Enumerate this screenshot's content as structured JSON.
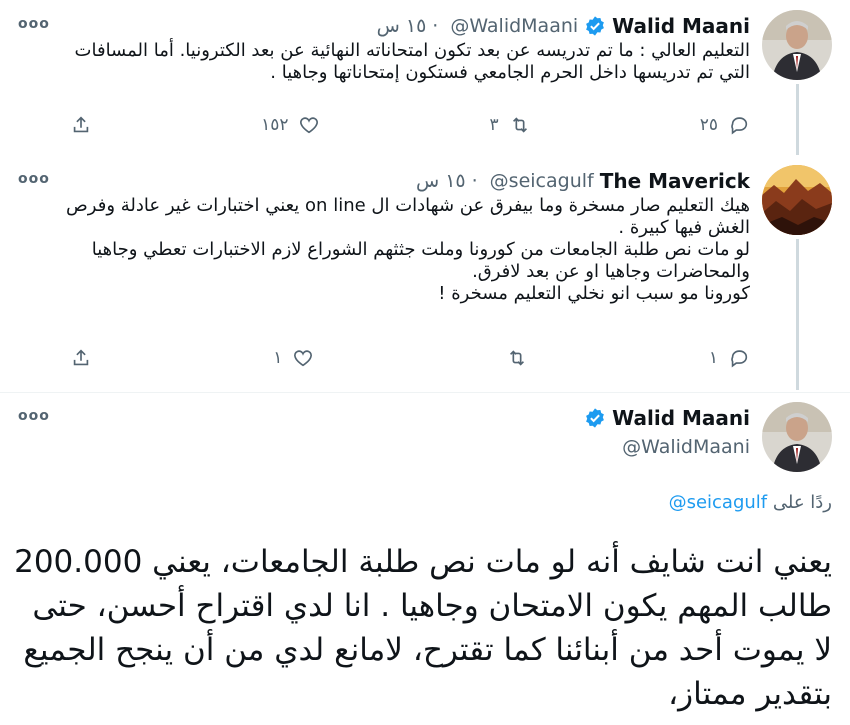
{
  "tweets": [
    {
      "name": "Walid Maani",
      "handle": "@WalidMaani",
      "time": "١٥ س",
      "text": "التعليم العالي : ما تم تدريسه عن بعد تكون امتحاناته النهائية عن بعد الكترونيا. أما المسافات التي تم تدريسها  داخل الحرم الجامعي فستكون إمتحاناتها وجاهيا .",
      "replies": "٢٥",
      "retweets": "٣",
      "likes": "١٥٢",
      "verified": true
    },
    {
      "name": "The Maverick",
      "handle": "@seicagulf",
      "time": "١٥ س",
      "text": "هيك التعليم صار مسخرة وما بيفرق عن شهادات ال on line يعني اختبارات غير عادلة وفرص الغش فيها كبيرة .\nلو مات نص طلبة الجامعات من كورونا وملت جثثهم الشوراع لازم الاختبارات تعطي وجاهيا والمحاضرات وجاهيا او عن بعد لافرق.\nكورونا مو سبب انو نخلي التعليم مسخرة !",
      "replies": "١",
      "retweets": "",
      "likes": "١",
      "verified": false
    }
  ],
  "main_tweet": {
    "name": "Walid Maani",
    "handle": "@WalidMaani",
    "reply_prefix": "ردًا على",
    "reply_handle": "@seicagulf",
    "text": "يعني انت شايف أنه لو مات نص طلبة الجامعات، يعني 200.000 طالب المهم يكون الامتحان وجاهيا . انا لدي اقتراح أحسن، حتى لا يموت أحد من أبنائنا كما تقترح، لامانع لدي من أن ينجح الجميع بتقدير ممتاز،"
  },
  "icons": {
    "more": "more-icon",
    "reply": "reply-icon",
    "retweet": "retweet-icon",
    "like": "like-icon",
    "share": "share-icon",
    "verified": "verified-badge-icon"
  },
  "more_label": "ooo",
  "colors": {
    "accent": "#1d9bf0",
    "muted": "#536471",
    "text": "#0f1419"
  }
}
